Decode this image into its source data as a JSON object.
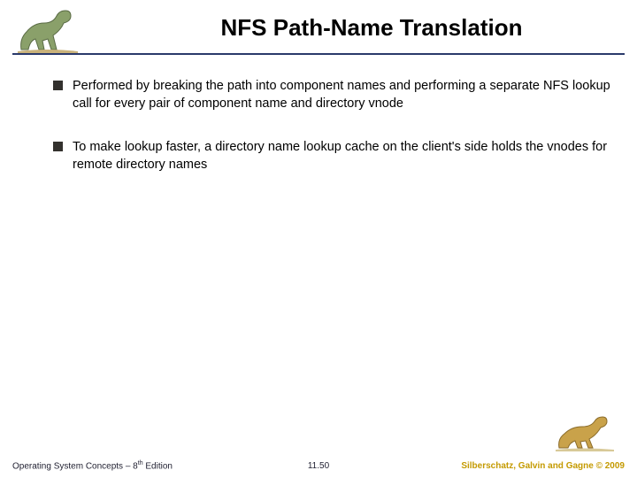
{
  "header": {
    "title": "NFS Path-Name Translation"
  },
  "bullets": [
    {
      "text": "Performed by breaking the path into component names and performing a separate NFS lookup call for every pair of component name and directory vnode"
    },
    {
      "text": "To make lookup faster, a directory name lookup cache on the client's side holds the vnodes for remote directory names"
    }
  ],
  "footer": {
    "left_a": "Operating System Concepts – 8",
    "left_sup": "th",
    "left_b": " Edition",
    "center": "11.50",
    "right": "Silberschatz, Galvin and Gagne © 2009"
  },
  "icons": {
    "dino_left": "dinosaur-icon",
    "dino_right": "dinosaur-icon"
  }
}
